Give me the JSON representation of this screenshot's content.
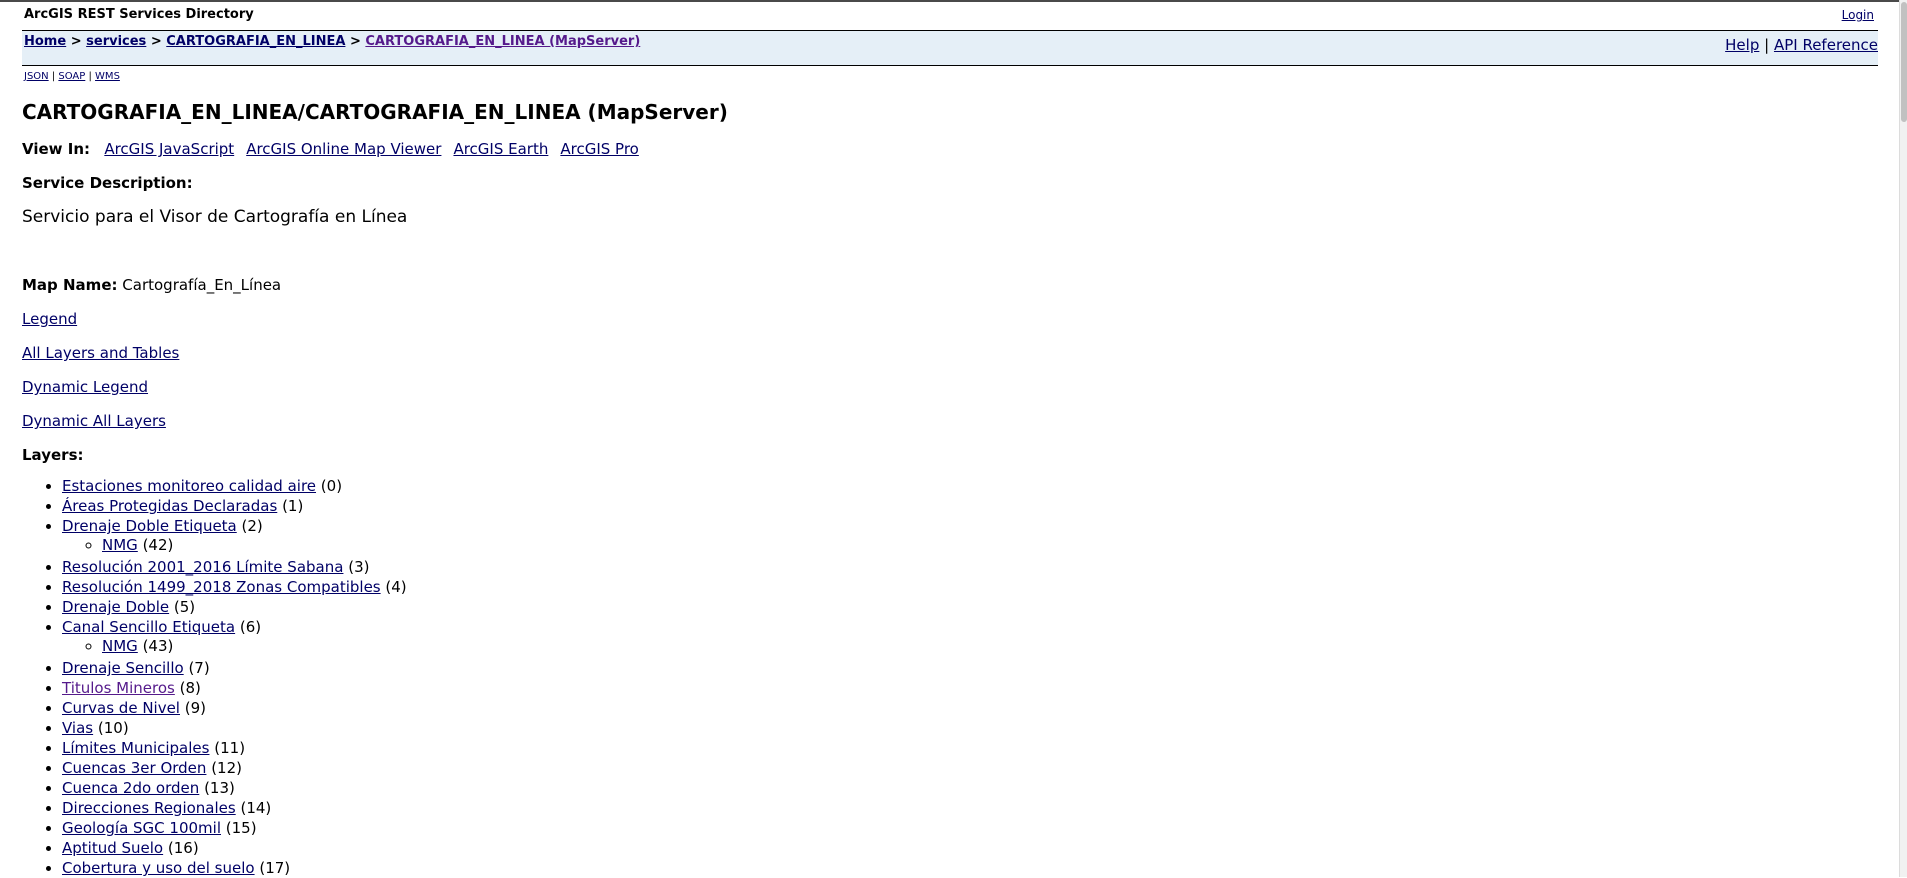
{
  "header": {
    "app_title": "ArcGIS REST Services Directory",
    "login": "Login"
  },
  "breadcrumb": {
    "home": "Home",
    "services": "services",
    "folder": "CARTOGRAFIA_EN_LINEA",
    "current": "CARTOGRAFIA_EN_LINEA (MapServer)",
    "separator": " > "
  },
  "nav": {
    "help": "Help",
    "separator": " | ",
    "api_reference": "API Reference"
  },
  "formats": {
    "json": "JSON",
    "soap": "SOAP",
    "wms": "WMS",
    "separator": " | "
  },
  "service": {
    "title": "CARTOGRAFIA_EN_LINEA/CARTOGRAFIA_EN_LINEA (MapServer)",
    "view_in_label": "View In:",
    "view_in": [
      "ArcGIS JavaScript",
      "ArcGIS Online Map Viewer",
      "ArcGIS Earth",
      "ArcGIS Pro"
    ],
    "description_label": "Service Description:",
    "description": "Servicio para el Visor de Cartografía en Línea",
    "map_name_label": "Map Name:",
    "map_name": "Cartografía_En_Línea",
    "links": [
      "Legend",
      "All Layers and Tables",
      "Dynamic Legend",
      "Dynamic All Layers"
    ],
    "layers_label": "Layers:"
  },
  "layers": [
    {
      "name": "Estaciones monitoreo calidad aire",
      "id": "(0)"
    },
    {
      "name": "Áreas Protegidas Declaradas",
      "id": "(1)"
    },
    {
      "name": "Drenaje Doble Etiqueta",
      "id": "(2)",
      "sub": {
        "name": "NMG",
        "id": "(42)"
      }
    },
    {
      "name": "Resolución 2001_2016 Límite Sabana",
      "id": "(3)"
    },
    {
      "name": "Resolución 1499_2018 Zonas Compatibles",
      "id": "(4)"
    },
    {
      "name": "Drenaje Doble",
      "id": "(5)"
    },
    {
      "name": "Canal Sencillo Etiqueta",
      "id": "(6)",
      "sub": {
        "name": "NMG",
        "id": "(43)"
      }
    },
    {
      "name": "Drenaje Sencillo",
      "id": "(7)"
    },
    {
      "name": "Titulos Mineros",
      "id": "(8)"
    },
    {
      "name": "Curvas de Nivel",
      "id": "(9)"
    },
    {
      "name": "Vias",
      "id": "(10)"
    },
    {
      "name": "Límites Municipales",
      "id": "(11)"
    },
    {
      "name": "Cuencas 3er Orden",
      "id": "(12)"
    },
    {
      "name": "Cuenca 2do orden",
      "id": "(13)"
    },
    {
      "name": "Direcciones Regionales",
      "id": "(14)"
    },
    {
      "name": "Geología SGC 100mil",
      "id": "(15)"
    },
    {
      "name": "Aptitud Suelo",
      "id": "(16)"
    },
    {
      "name": "Cobertura y uso del suelo",
      "id": "(17)"
    }
  ]
}
